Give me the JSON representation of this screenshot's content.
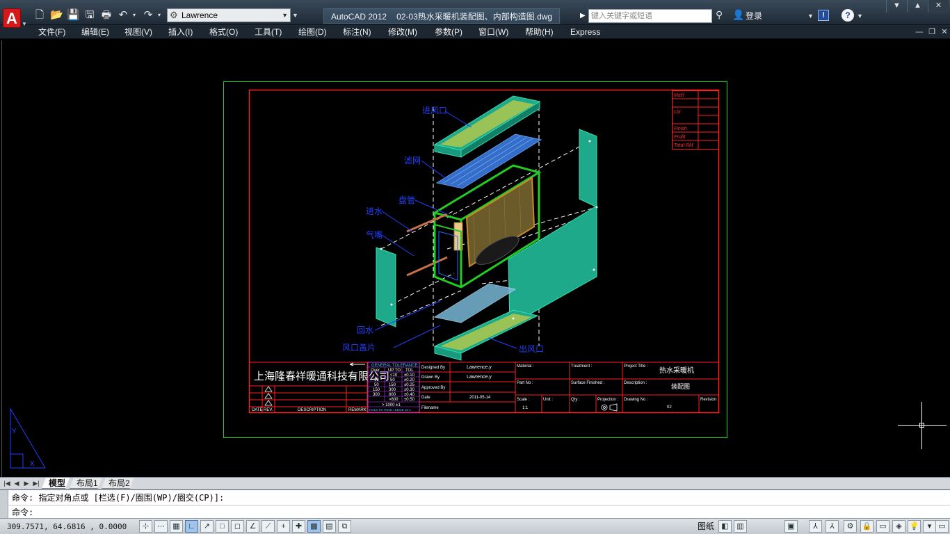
{
  "title_bar": {
    "app_title": "AutoCAD 2012",
    "document_title": "02-03热水采暖机装配图、内部构造图.dwg",
    "workspace": "Lawrence",
    "search_placeholder": "键入关键字或短语",
    "login_label": "登录",
    "app_logo": "A"
  },
  "quick_access": [
    {
      "name": "new-icon",
      "glyph": "🗋"
    },
    {
      "name": "open-icon",
      "glyph": "📂"
    },
    {
      "name": "save-icon",
      "glyph": "💾"
    },
    {
      "name": "save-as-icon",
      "glyph": "🖫"
    },
    {
      "name": "print-icon",
      "glyph": "🖶"
    },
    {
      "name": "undo-icon",
      "glyph": "↶"
    },
    {
      "name": "redo-icon",
      "glyph": "↷"
    }
  ],
  "menu": [
    "文件(F)",
    "编辑(E)",
    "视图(V)",
    "插入(I)",
    "格式(O)",
    "工具(T)",
    "绘图(D)",
    "标注(N)",
    "修改(M)",
    "参数(P)",
    "窗口(W)",
    "帮助(H)",
    "Express"
  ],
  "drawing": {
    "company": "上海隆春祥暖通科技有限公司",
    "labels": {
      "inlet": "进风口",
      "filter": "滤网",
      "coil": "盘管",
      "water_in": "进水",
      "air_vent": "气嘴",
      "water_out": "回水",
      "grille": "风口盖片",
      "outlet": "出风口"
    },
    "mat_table": [
      "Mat'l",
      "Lbr",
      "Finish",
      "Profit",
      "Total RM"
    ],
    "tolerance": {
      "title": "GENERAL TOLERANCE",
      "headers": [
        "Over",
        "UP TO",
        "TOL"
      ],
      "rows": [
        [
          "",
          "<10",
          "±0.10"
        ],
        [
          "10",
          "50",
          "±0.20"
        ],
        [
          "50",
          "150",
          "±0.25"
        ],
        [
          "150",
          "300",
          "±0.30"
        ],
        [
          "300",
          "800",
          "±0.40"
        ],
        [
          "",
          ">800",
          "±0.50"
        ]
      ],
      "footer": "> 1000  ±1",
      "note": "HOLE TO HOLE / EDGE ±0.1"
    },
    "revision_headers": [
      "DATE",
      "REV.",
      "DESCRIPTION",
      "REMARK"
    ],
    "title_block": {
      "designed_by_label": "Designed By",
      "designed_by": "Lawrence.y",
      "drawn_by_label": "Drawn By",
      "drawn_by": "Lawrence.y",
      "approved_by_label": "Approved By",
      "date_label": "Date",
      "date": "2011-05-14",
      "filename_label": "Filename",
      "material_label": "Material :",
      "treatment_label": "Treatment :",
      "project_title_label": "Project Title :",
      "project_title": "热水采暖机",
      "part_no_label": "Part No :",
      "surface_label": "Surface Finished :",
      "description_label": "Description :",
      "description": "装配图",
      "scale_label": "Scale :",
      "scale": "1:1",
      "unit_label": "Unit :",
      "qty_label": "Qty :",
      "projection_label": "Projection :",
      "drawing_no_label": "Drawing No :",
      "drawing_no": "02",
      "revision_label": "Revision"
    }
  },
  "ucs": {
    "y_label": "Y",
    "x_label": "X"
  },
  "tabs": [
    "模型",
    "布局1",
    "布局2"
  ],
  "command": {
    "history": "命令: 指定对角点或 [栏选(F)/圈围(WP)/圈交(CP)]:",
    "prompt": "命令:"
  },
  "status": {
    "coordinates": "309.7571, 64.6816 , 0.0000",
    "layout_label": "图纸"
  },
  "colors": {
    "frame_outer": "#22cc22",
    "frame_inner": "#ff2020",
    "label": "#2040ff",
    "panel": "#1ea98a"
  }
}
